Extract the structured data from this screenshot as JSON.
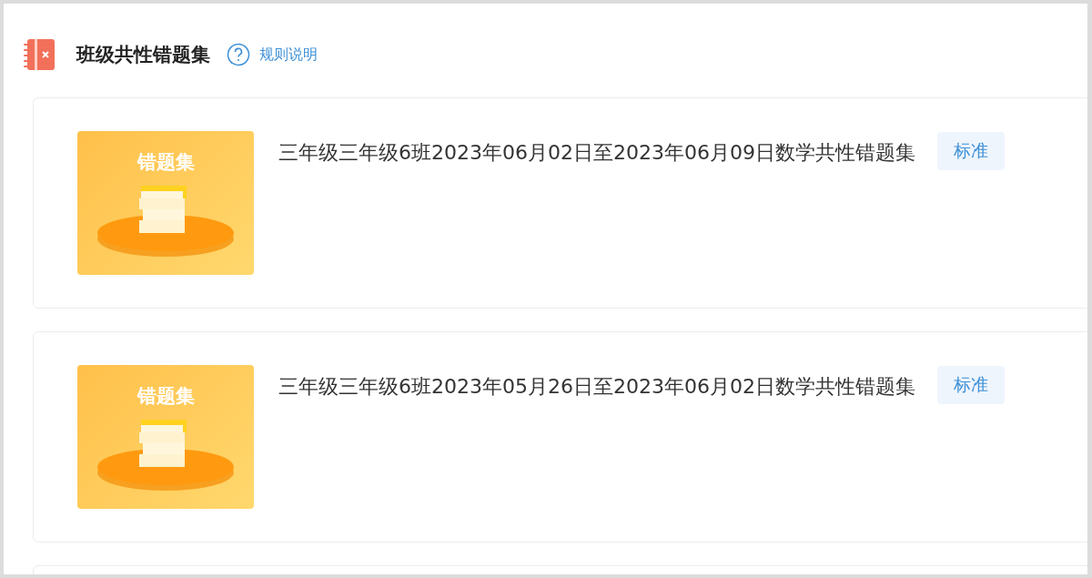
{
  "header": {
    "title": "班级共性错题集",
    "help_link": "规则说明"
  },
  "items": [
    {
      "kind": "full",
      "cover_title": "错题集",
      "title": "三年级三年级6班2023年06月02日至2023年06月09日数学共性错题集",
      "tag": "标准"
    },
    {
      "kind": "full",
      "cover_title": "错题集",
      "title": "三年级三年级6班2023年05月26日至2023年06月02日数学共性错题集",
      "tag": "标准"
    },
    {
      "kind": "partial"
    }
  ]
}
